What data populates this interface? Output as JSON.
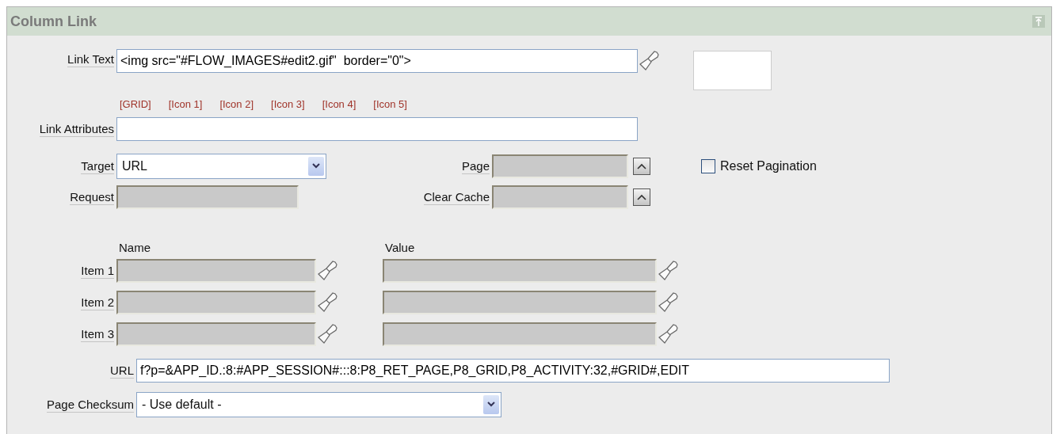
{
  "panel": {
    "title": "Column Link"
  },
  "link_text": {
    "label": "Link Text",
    "value": "<img src=\"#FLOW_IMAGES#edit2.gif\"  border=\"0\">",
    "shortcuts": [
      "[GRID]",
      "[Icon 1]",
      "[Icon 2]",
      "[Icon 3]",
      "[Icon 4]",
      "[Icon 5]"
    ]
  },
  "link_attributes": {
    "label": "Link Attributes"
  },
  "target": {
    "label": "Target",
    "value": "URL"
  },
  "page": {
    "label": "Page",
    "disabled": true
  },
  "request": {
    "label": "Request",
    "disabled": true
  },
  "clear_cache": {
    "label": "Clear Cache",
    "disabled": true
  },
  "reset_pagination": {
    "label": "Reset Pagination",
    "checked": false
  },
  "items": {
    "columns": [
      "Name",
      "Value"
    ],
    "rows": [
      {
        "label": "Item 1",
        "disabled": true
      },
      {
        "label": "Item 2",
        "disabled": true
      },
      {
        "label": "Item 3",
        "disabled": true
      }
    ]
  },
  "url": {
    "label": "URL",
    "value": "f?p=&APP_ID.:8:#APP_SESSION#:::8:P8_RET_PAGE,P8_GRID,P8_ACTIVITY:32,#GRID#,EDIT"
  },
  "page_checksum": {
    "label": "Page Checksum",
    "value": "- Use default -"
  }
}
